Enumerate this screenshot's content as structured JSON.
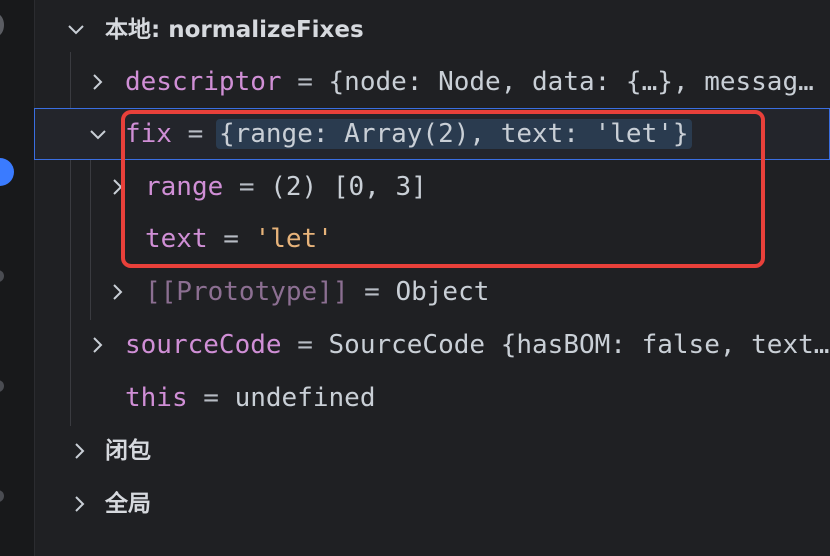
{
  "window": {
    "accent_color": "#3a6ee0",
    "annotation_color": "#e8403a"
  },
  "scopes": {
    "local": {
      "label": "本地: normalizeFixes",
      "vars": {
        "descriptor": {
          "name": "descriptor",
          "eq": " = ",
          "value": "{node: Node, data: {…}, messag…"
        },
        "fix": {
          "name": "fix",
          "eq": " = ",
          "value": "{range: Array(2), text: 'let'}"
        },
        "range": {
          "name": "range",
          "eq": " = ",
          "value": "(2) [0, 3]"
        },
        "text": {
          "name": "text",
          "eq": " = ",
          "value": "'let'"
        },
        "prototype": {
          "name": "[[Prototype]]",
          "eq": " = ",
          "value": "Object"
        },
        "sourceCode": {
          "name": "sourceCode",
          "eq": " = ",
          "value": "SourceCode {hasBOM: false, text…"
        },
        "this": {
          "name": "this",
          "eq": " = ",
          "value": "undefined"
        }
      }
    },
    "closure": {
      "label": "闭包"
    },
    "global": {
      "label": "全局"
    }
  },
  "icons": {
    "expanded": "chevron-down-icon",
    "collapsed": "chevron-right-icon"
  }
}
